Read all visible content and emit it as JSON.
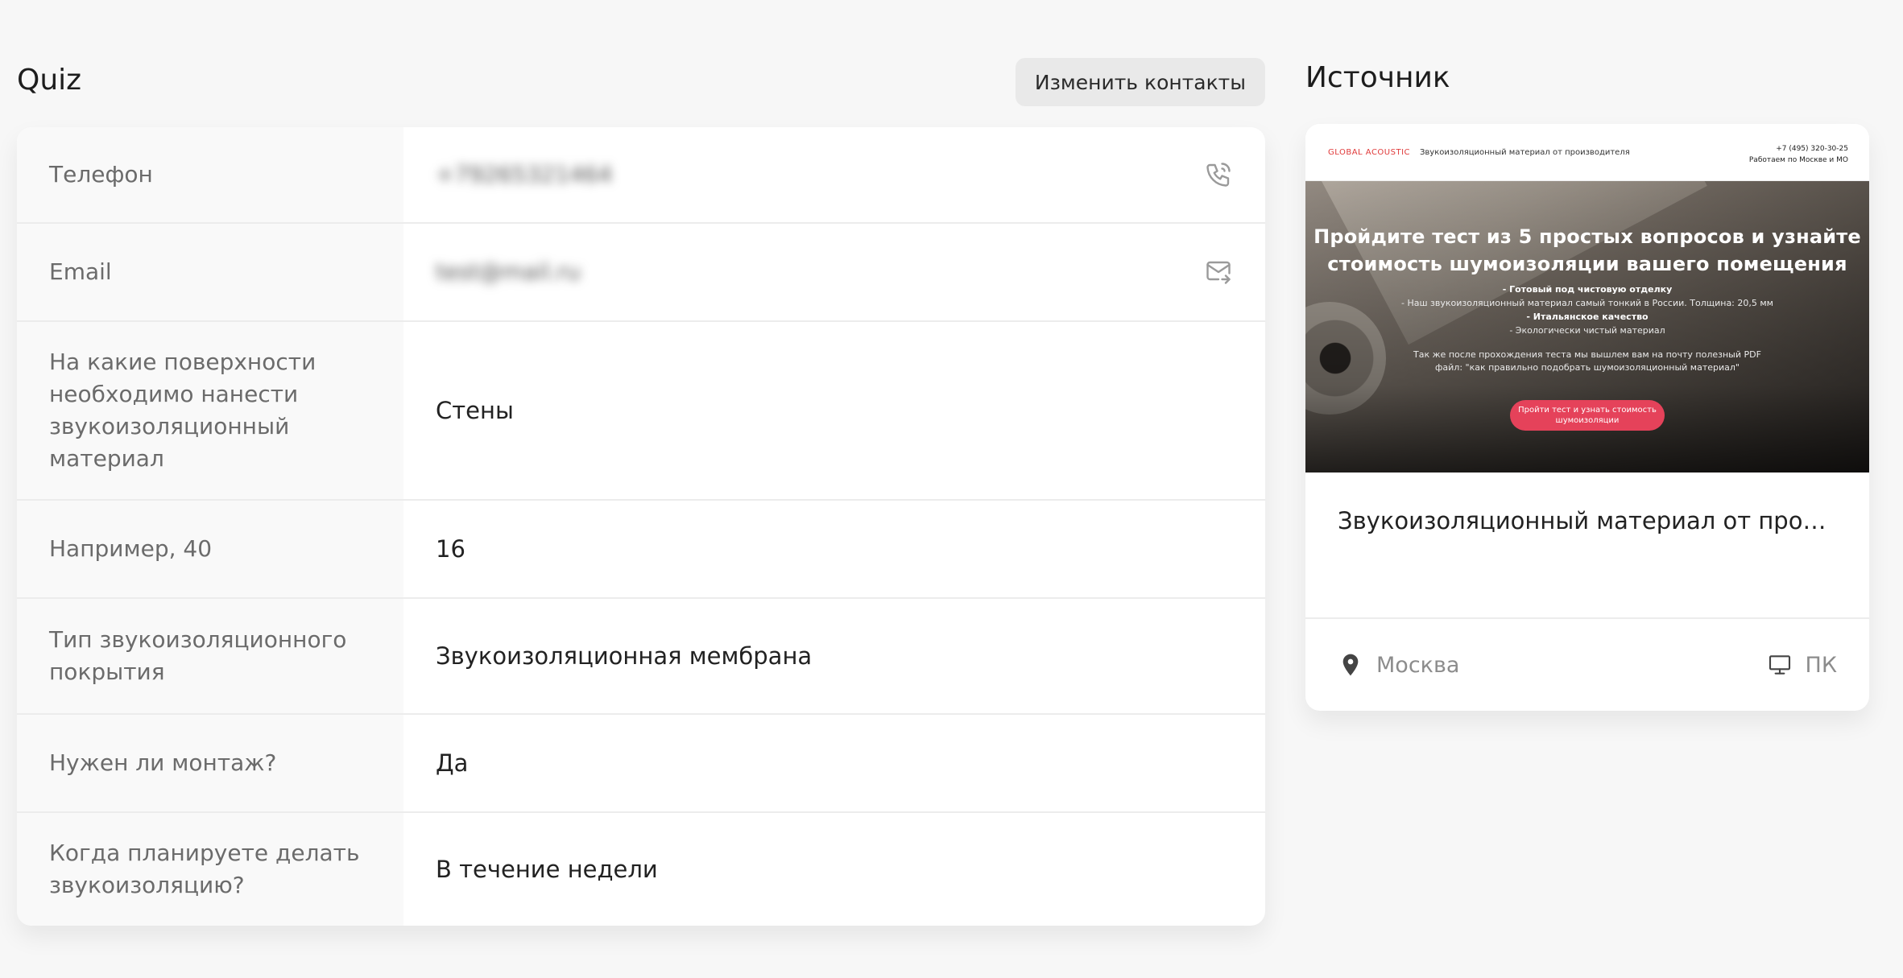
{
  "header": {
    "title": "Quiz",
    "change_contacts_label": "Изменить контакты"
  },
  "fields": [
    {
      "label": "Телефон",
      "value": "+79265321464"
    },
    {
      "label": "Email",
      "value": "test@mail.ru"
    },
    {
      "label": "На какие поверхности необходимо нанести звукоизоляционный материал",
      "value": "Стены"
    },
    {
      "label": "Например, 40",
      "value": "16"
    },
    {
      "label": "Тип звукоизоляционного покрытия",
      "value": "Звукоизоляционная мембрана"
    },
    {
      "label": "Нужен ли монтаж?",
      "value": "Да"
    },
    {
      "label": "Когда планируете делать звукоизоляцию?",
      "value": "В течение недели"
    }
  ],
  "source": {
    "title": "Источник",
    "preview": {
      "logo": "GLOBAL ACOUSTIC",
      "tagline": "Звукоизоляционный материал от производителя",
      "phone": "+7 (495) 320-30-25",
      "region": "Работаем по Москве и МО",
      "headline": "Пройдите тест из 5 простых вопросов и узнайте стоимость шумоизоляции вашего помещения",
      "bullet_1": "- Готовый под чистовую отделку",
      "bullet_2": "- Наш звукоизоляционный материал самый тонкий в России. Толщина: 20,5 мм",
      "bullet_3": "- Итальянское качество",
      "bullet_4": "- Экологически чистый материал",
      "note": "Так же после прохождения теста мы вышлем вам на почту полезный PDF файл: \"как правильно подобрать шумоизоляционный материал\"",
      "cta": "Пройти тест и узнать стоимость шумоизоляции"
    },
    "page_name": "Звукоизоляционный материал от производителя",
    "city": "Москва",
    "device": "ПК"
  },
  "icons": {
    "phone": "phone-call-icon",
    "email": "mail-forward-icon",
    "location": "map-pin-icon",
    "device": "desktop-icon"
  }
}
